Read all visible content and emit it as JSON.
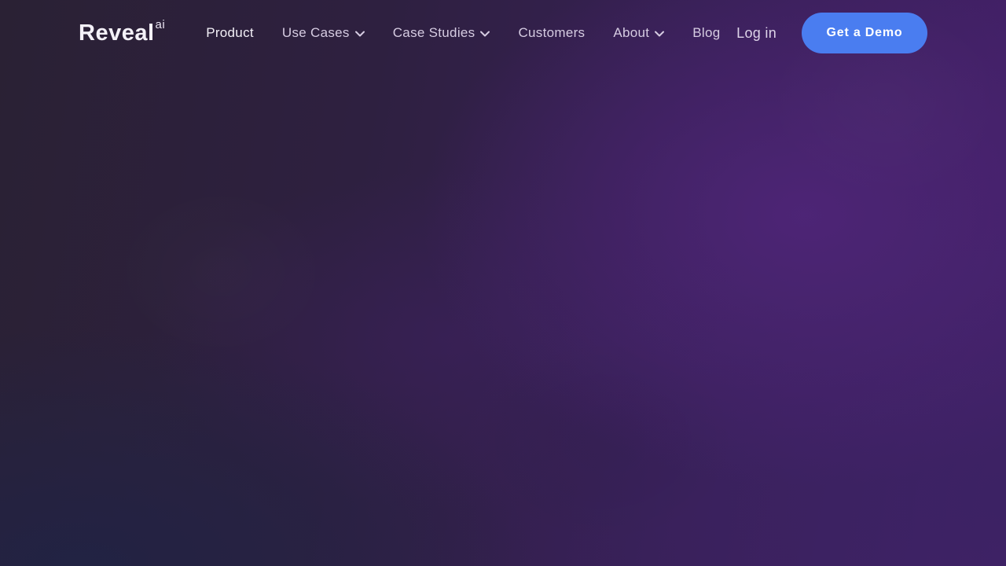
{
  "brand": {
    "name": "Reveal",
    "suffix": "ai"
  },
  "nav": {
    "items": [
      {
        "label": "Product",
        "has_dropdown": false
      },
      {
        "label": "Use Cases",
        "has_dropdown": true
      },
      {
        "label": "Case Studies",
        "has_dropdown": true
      },
      {
        "label": "Customers",
        "has_dropdown": false
      },
      {
        "label": "About",
        "has_dropdown": true
      },
      {
        "label": "Blog",
        "has_dropdown": false
      }
    ]
  },
  "actions": {
    "login_label": "Log in",
    "demo_label": "Get a Demo"
  },
  "colors": {
    "accent_blue": "#4a7df0",
    "background_dark": "#2a2134",
    "background_bright": "#4b2373",
    "nav_text": "#d6cce2"
  }
}
